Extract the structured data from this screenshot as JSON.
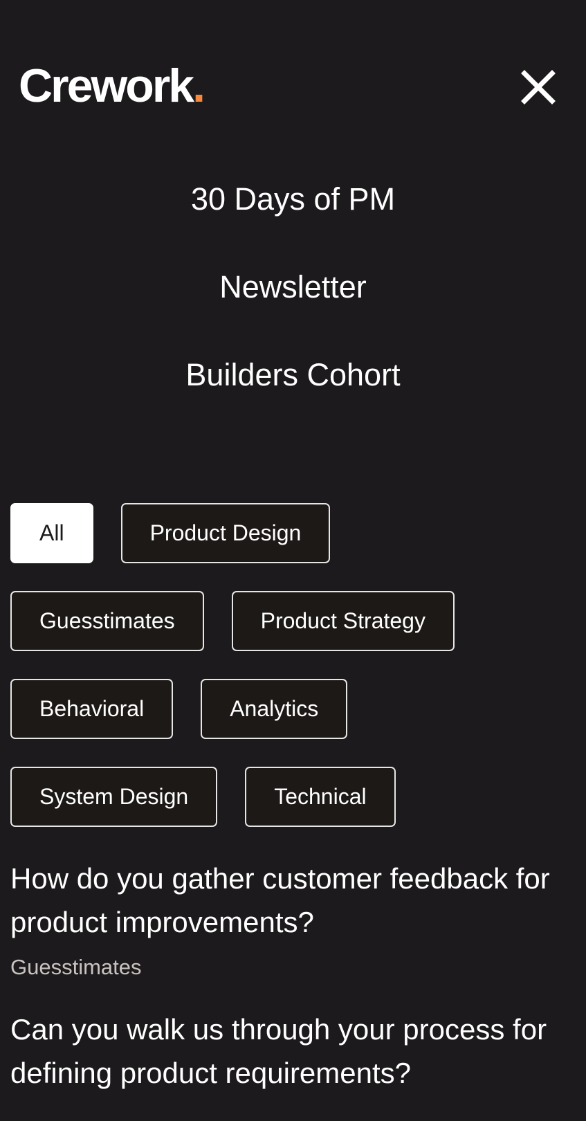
{
  "header": {
    "logo_text": "Crework",
    "logo_dot": ".",
    "close_icon": "close-icon"
  },
  "nav": {
    "items": [
      {
        "label": "30 Days of PM"
      },
      {
        "label": "Newsletter"
      },
      {
        "label": "Builders Cohort"
      }
    ]
  },
  "filters": {
    "selected": "All",
    "chips": [
      {
        "label": "All"
      },
      {
        "label": "Product Design"
      },
      {
        "label": "Guesstimates"
      },
      {
        "label": "Product Strategy"
      },
      {
        "label": "Behavioral"
      },
      {
        "label": "Analytics"
      },
      {
        "label": "System Design"
      },
      {
        "label": "Technical"
      }
    ]
  },
  "questions": [
    {
      "title": "How do you gather customer feedback for product improvements?",
      "category": "Guesstimates"
    },
    {
      "title": "Can you walk us through your process for defining product requirements?",
      "category": ""
    }
  ],
  "colors": {
    "background": "#1c1a1c",
    "accent": "#f5883c",
    "chip_background": "#1d1917",
    "chip_border": "#e6e6e6",
    "muted_text": "#c9c3c0"
  }
}
